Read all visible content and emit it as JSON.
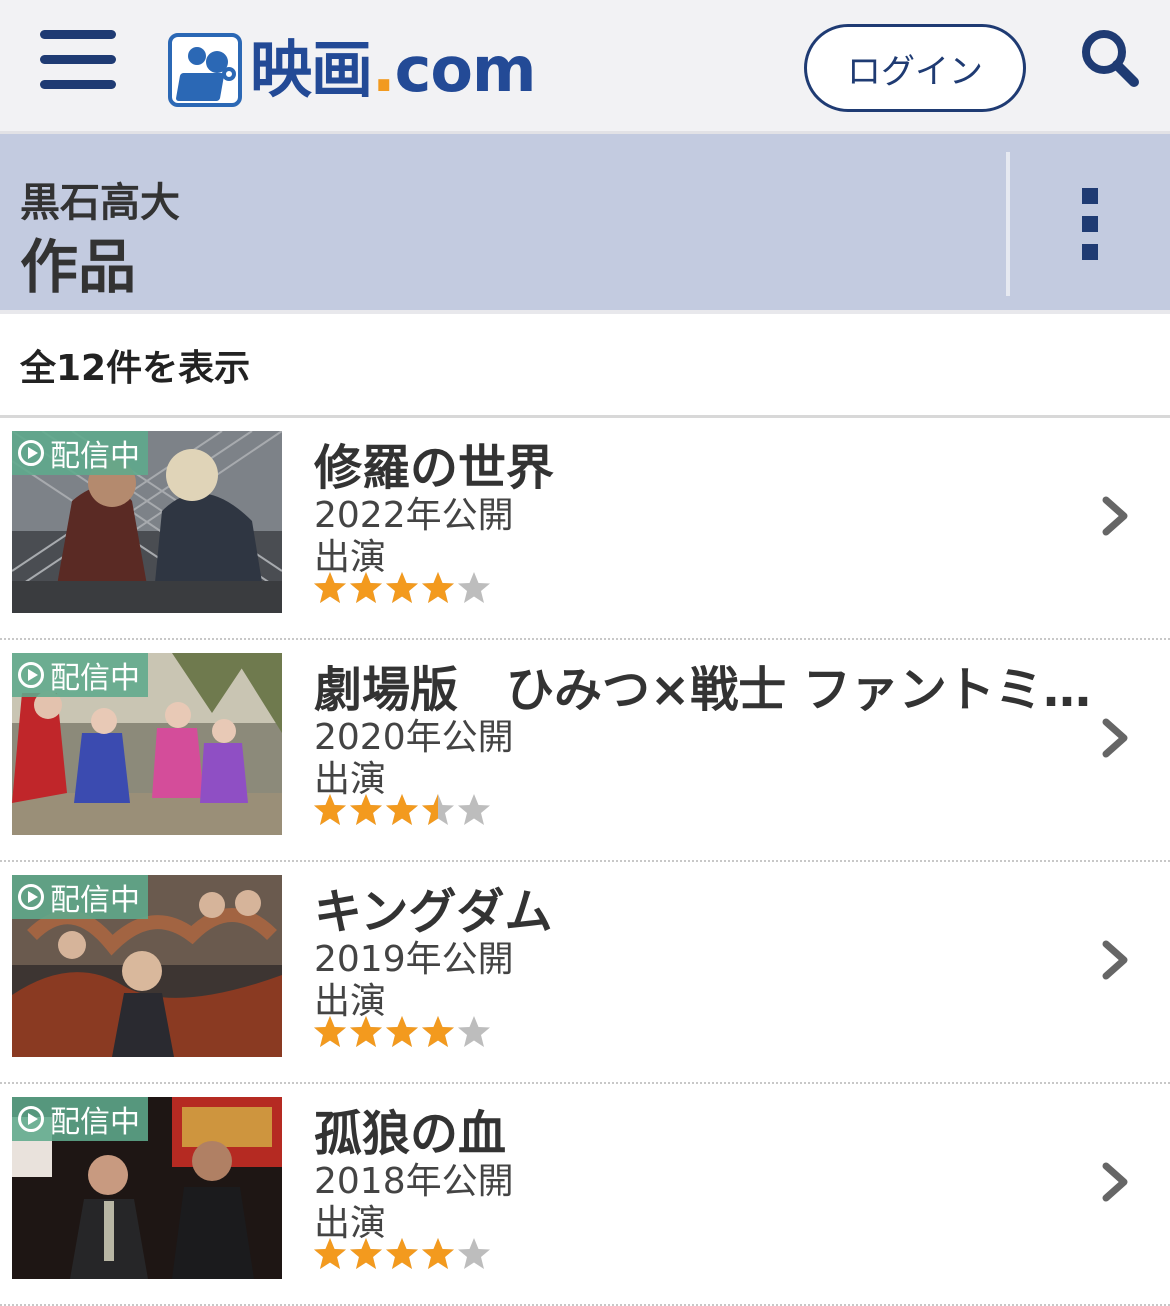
{
  "header": {
    "logo_text": "映画",
    "logo_dot": ".",
    "logo_suffix": "com",
    "login_label": "ログイン"
  },
  "titlebar": {
    "person_name": "黒石高大",
    "section_title": "作品"
  },
  "count_label": "全12件を表示",
  "colors": {
    "brand_navy": "#1f3b73",
    "title_band": "#c3cbe0",
    "badge_green": "#5eaa8c",
    "star_orange": "#f39a1e",
    "star_empty": "#bdbdbd"
  },
  "movies": [
    {
      "badge": "配信中",
      "title": "修羅の世界",
      "year": "2022年公開",
      "role": "出演",
      "rating": 4.0
    },
    {
      "badge": "配信中",
      "title": "劇場版　ひみつ×戦士 ファントミラージュ！ ～映画になってちょーだいします～",
      "year": "2020年公開",
      "role": "出演",
      "rating": 3.5
    },
    {
      "badge": "配信中",
      "title": "キングダム",
      "year": "2019年公開",
      "role": "出演",
      "rating": 4.0
    },
    {
      "badge": "配信中",
      "title": "孤狼の血",
      "year": "2018年公開",
      "role": "出演",
      "rating": 4.0
    }
  ]
}
